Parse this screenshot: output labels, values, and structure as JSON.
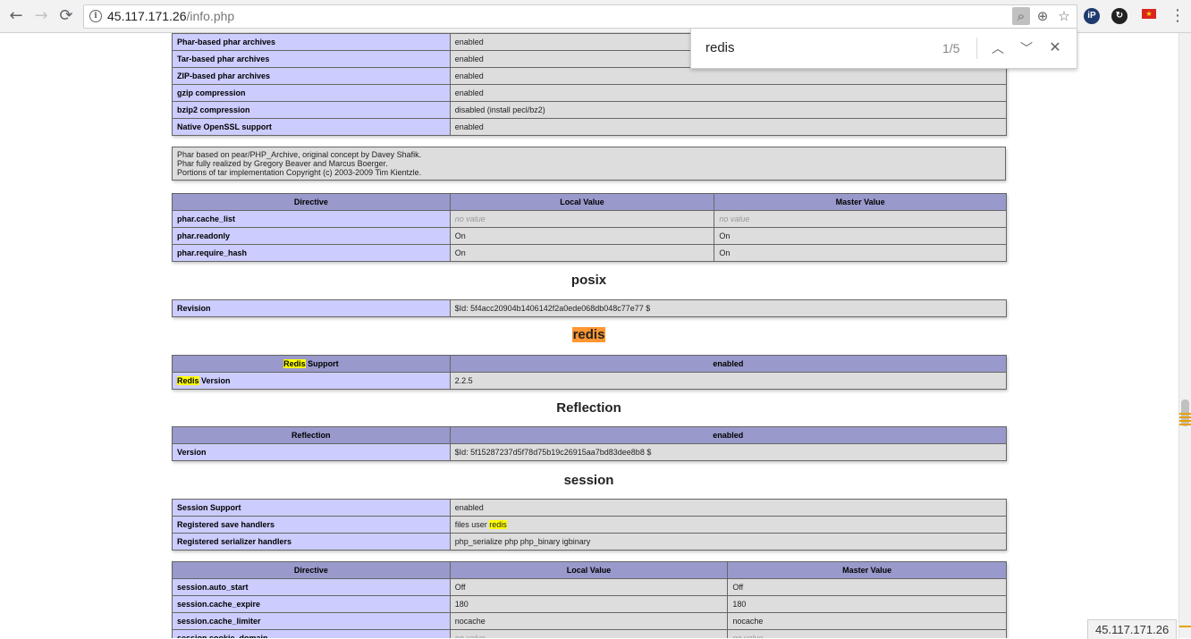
{
  "browser": {
    "url_host": "45.117.171.26",
    "url_path": "/info.php",
    "status_url": "45.117.171.26",
    "icons": [
      "back-arrow-icon",
      "forward-arrow-icon",
      "reload-icon",
      "info-icon",
      "find-indicator-icon",
      "zoom-icon",
      "star-icon",
      "ip-extension-icon",
      "sync-extension-icon",
      "flag-icon",
      "menu-icon"
    ]
  },
  "find_bar": {
    "query": "redis",
    "count": "1/5"
  },
  "phar_support": [
    {
      "key": "Phar-based phar archives",
      "value": "enabled"
    },
    {
      "key": "Tar-based phar archives",
      "value": "enabled"
    },
    {
      "key": "ZIP-based phar archives",
      "value": "enabled"
    },
    {
      "key": "gzip compression",
      "value": "enabled"
    },
    {
      "key": "bzip2 compression",
      "value": "disabled (install pecl/bz2)"
    },
    {
      "key": "Native OpenSSL support",
      "value": "enabled"
    }
  ],
  "phar_note": [
    "Phar based on pear/PHP_Archive, original concept by Davey Shafik.",
    "Phar fully realized by Gregory Beaver and Marcus Boerger.",
    "Portions of tar implementation Copyright (c) 2003-2009 Tim Kientzle."
  ],
  "directive_headers": {
    "directive": "Directive",
    "local": "Local Value",
    "master": "Master Value"
  },
  "phar_directives": [
    {
      "name": "phar.cache_list",
      "local": "no value",
      "master": "no value"
    },
    {
      "name": "phar.readonly",
      "local": "On",
      "master": "On"
    },
    {
      "name": "phar.require_hash",
      "local": "On",
      "master": "On"
    }
  ],
  "posix": {
    "title": "posix",
    "revision_key": "Revision",
    "revision_value": "$Id: 5f4acc20904b1406142f2a0ede068db048c77e77 $"
  },
  "redis": {
    "title": "redis",
    "support_word": "Redis",
    "support_suffix": " Support",
    "support_value": "enabled",
    "version_word": "Redis",
    "version_suffix": " Version",
    "version_value": "2.2.5"
  },
  "reflection": {
    "title": "Reflection",
    "header_key": "Reflection",
    "header_value": "enabled",
    "version_key": "Version",
    "version_value": "$Id: 5f15287237d5f78d75b19c26915aa7bd83dee8b8 $"
  },
  "session": {
    "title": "session",
    "support_key": "Session Support",
    "support_value": "enabled",
    "handlers_key": "Registered save handlers",
    "handlers_prefix": "files user ",
    "handlers_match": "redis",
    "serializer_key": "Registered serializer handlers",
    "serializer_value": "php_serialize php php_binary igbinary",
    "directives": [
      {
        "name": "session.auto_start",
        "local": "Off",
        "master": "Off"
      },
      {
        "name": "session.cache_expire",
        "local": "180",
        "master": "180"
      },
      {
        "name": "session.cache_limiter",
        "local": "nocache",
        "master": "nocache"
      },
      {
        "name": "session.cookie_domain",
        "local": "no value",
        "master": "no value"
      }
    ]
  }
}
